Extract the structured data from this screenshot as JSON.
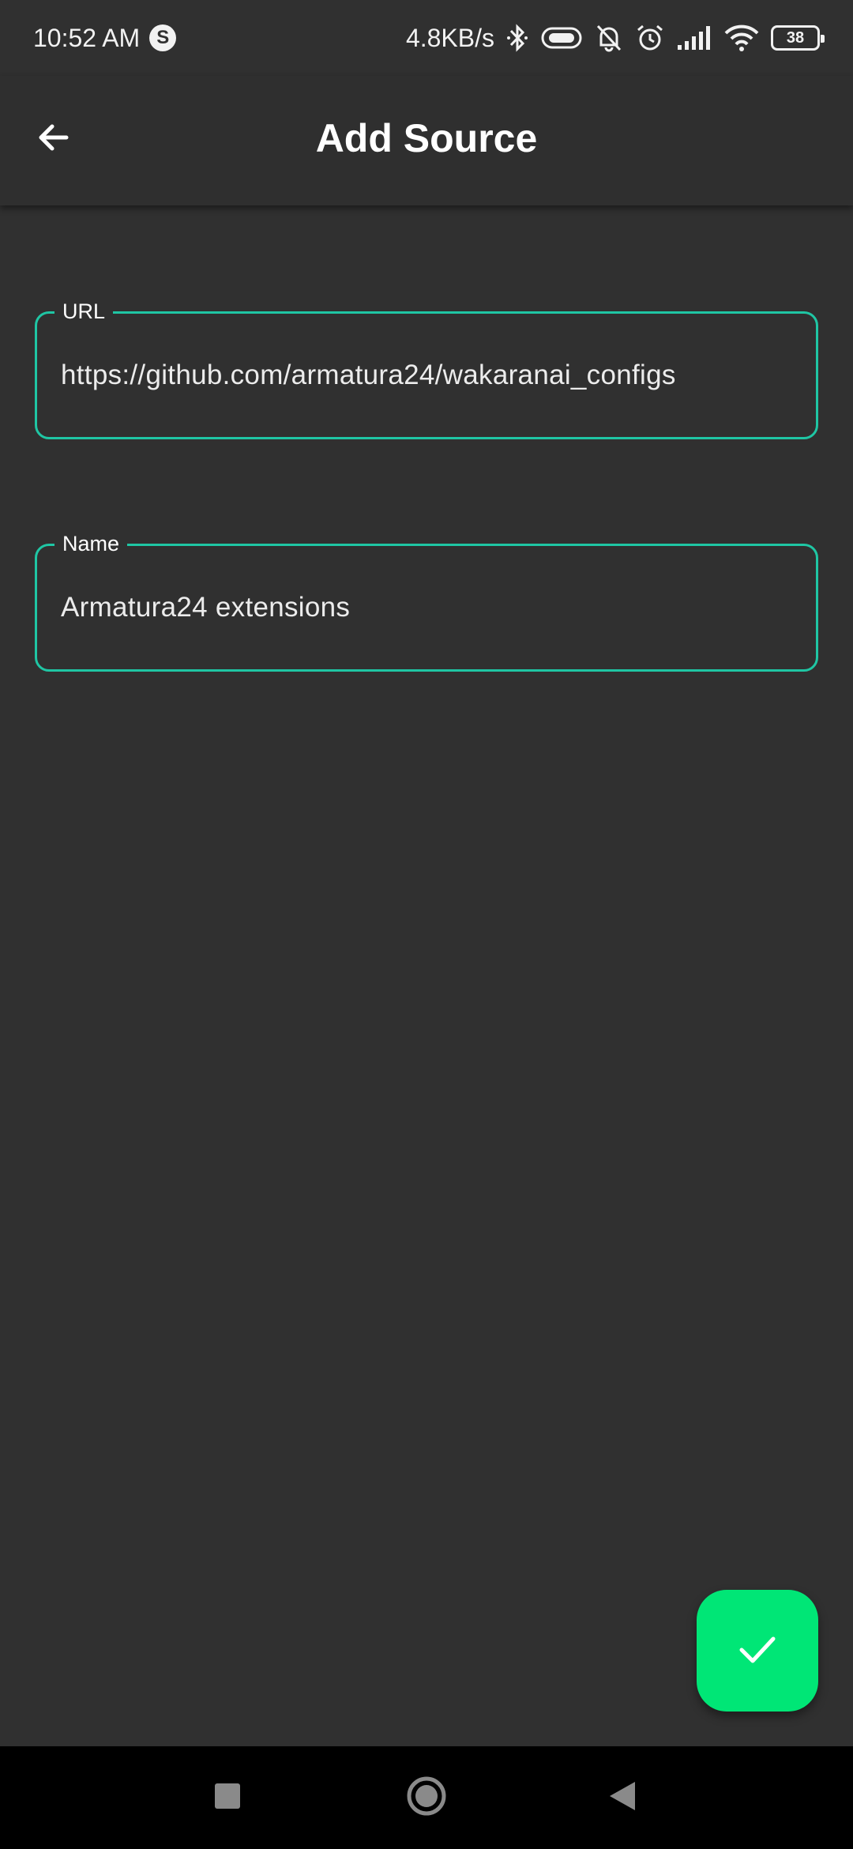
{
  "status_bar": {
    "time": "10:52 AM",
    "app_indicator": "S",
    "network_speed": "4.8KB/s",
    "battery_level": "38",
    "icons": [
      "bluetooth-icon",
      "vibrate-icon",
      "muted-bell-icon",
      "alarm-icon",
      "signal-icon",
      "wifi-icon",
      "battery-icon"
    ]
  },
  "app_bar": {
    "title": "Add Source",
    "back_icon": "arrow-back-icon"
  },
  "form": {
    "url": {
      "label": "URL",
      "value": "https://github.com/armatura24/wakaranai_configs"
    },
    "name": {
      "label": "Name",
      "value": "Armatura24 extensions"
    }
  },
  "fab": {
    "icon": "check-icon",
    "color": "#00e676"
  },
  "colors": {
    "background": "#303030",
    "accent_border": "#1fc6a4",
    "fab": "#00e676"
  },
  "nav_bar": {
    "buttons": [
      "recents-icon",
      "home-icon",
      "back-triangle-icon"
    ]
  }
}
